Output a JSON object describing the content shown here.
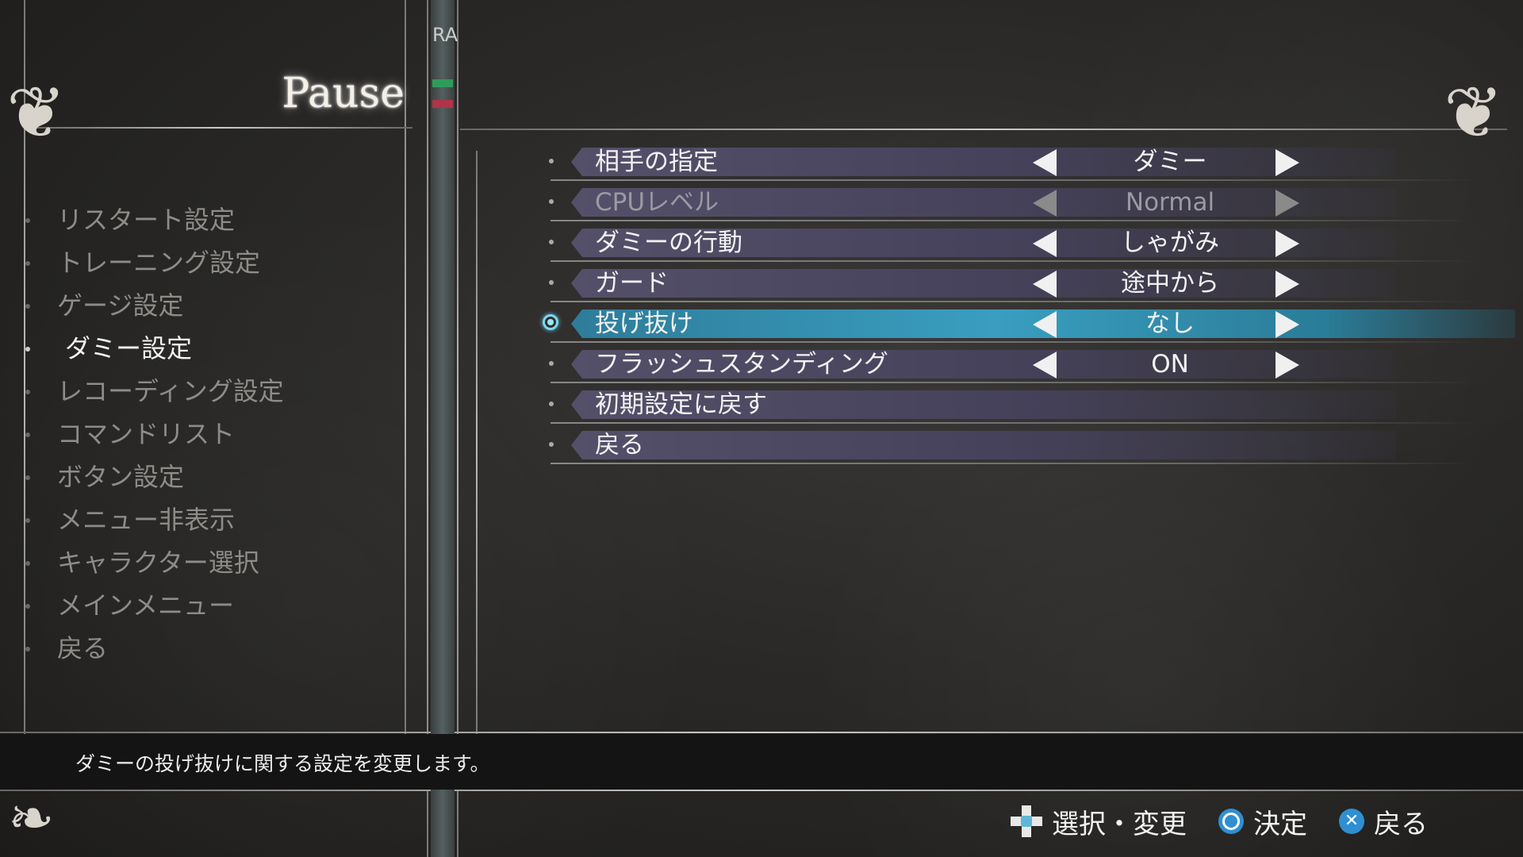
{
  "pause_title": "Pause",
  "mid_strip_text": "RA",
  "left_menu": [
    {
      "label": "リスタート設定",
      "active": false
    },
    {
      "label": "トレーニング設定",
      "active": false
    },
    {
      "label": "ゲージ設定",
      "active": false
    },
    {
      "label": "ダミー設定",
      "active": true
    },
    {
      "label": "レコーディング設定",
      "active": false
    },
    {
      "label": "コマンドリスト",
      "active": false
    },
    {
      "label": "ボタン設定",
      "active": false
    },
    {
      "label": "メニュー非表示",
      "active": false
    },
    {
      "label": "キャラクター選択",
      "active": false
    },
    {
      "label": "メインメニュー",
      "active": false
    },
    {
      "label": "戻る",
      "active": false
    }
  ],
  "settings": [
    {
      "label": "相手の指定",
      "value": "ダミー",
      "has_arrows": true,
      "state": "normal"
    },
    {
      "label": "CPUレベル",
      "value": "Normal",
      "has_arrows": true,
      "state": "dim"
    },
    {
      "label": "ダミーの行動",
      "value": "しゃがみ",
      "has_arrows": true,
      "state": "normal"
    },
    {
      "label": "ガード",
      "value": "途中から",
      "has_arrows": true,
      "state": "normal"
    },
    {
      "label": "投げ抜け",
      "value": "なし",
      "has_arrows": true,
      "state": "selected"
    },
    {
      "label": "フラッシュスタンディング",
      "value": "ON",
      "has_arrows": true,
      "state": "normal"
    },
    {
      "label": "初期設定に戻す",
      "value": "",
      "has_arrows": false,
      "state": "normal"
    },
    {
      "label": "戻る",
      "value": "",
      "has_arrows": false,
      "state": "normal"
    }
  ],
  "help_text": "ダミーの投げ抜けに関する設定を変更します。",
  "controls": {
    "select_change": "選択・変更",
    "confirm": "決定",
    "back": "戻る",
    "select_icon": "dpad-icon",
    "confirm_icon": "circle-button-icon",
    "back_icon": "cross-button-icon"
  },
  "colors": {
    "selected_bar": "#3a9ec0",
    "row_bar": "#55506a",
    "button_blue": "#2f8fd0"
  }
}
